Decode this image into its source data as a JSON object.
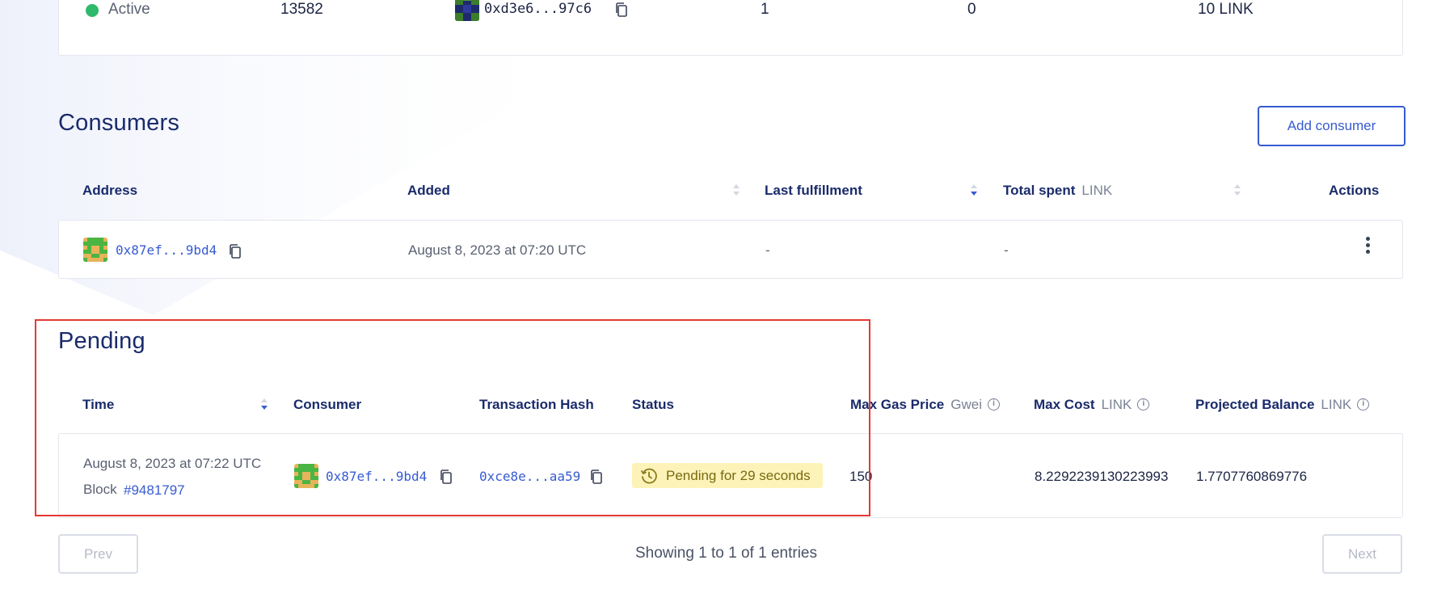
{
  "subscription_row": {
    "status": "Active",
    "id": "13582",
    "owner": "0xd3e6...97c6",
    "consumers_count": "1",
    "fulfillments": "0",
    "balance": "10 LINK"
  },
  "consumers": {
    "title": "Consumers",
    "add_button": "Add consumer",
    "columns": {
      "address": "Address",
      "added": "Added",
      "last_fulfillment": "Last fulfillment",
      "total_spent": "Total spent",
      "total_spent_unit": "LINK",
      "actions": "Actions"
    },
    "rows": [
      {
        "address": "0x87ef...9bd4",
        "added": "August 8, 2023 at 07:20 UTC",
        "last_fulfillment": "-",
        "total_spent": "-"
      }
    ]
  },
  "pending": {
    "title": "Pending",
    "columns": {
      "time": "Time",
      "consumer": "Consumer",
      "tx_hash": "Transaction Hash",
      "status": "Status",
      "max_gas_price": "Max Gas Price",
      "max_gas_price_unit": "Gwei",
      "max_cost": "Max Cost",
      "max_cost_unit": "LINK",
      "projected_balance": "Projected Balance",
      "projected_balance_unit": "LINK"
    },
    "rows": [
      {
        "time": "August 8, 2023 at 07:22 UTC",
        "block_label": "Block",
        "block": "#9481797",
        "consumer": "0x87ef...9bd4",
        "tx_hash": "0xce8e...aa59",
        "status": "Pending for 29 seconds",
        "max_gas_price": "150",
        "max_cost": "8.2292239130223993",
        "projected_balance": "1.7707760869776"
      }
    ]
  },
  "pagination": {
    "prev": "Prev",
    "next": "Next",
    "summary": "Showing 1 to 1 of 1 entries"
  },
  "colors": {
    "accent": "#375bd2",
    "heading": "#1a2b6b",
    "active": "#2fb96c",
    "pending_bg": "#fdf3b9",
    "highlight": "#e53935"
  },
  "icons": {
    "copy": "copy-icon",
    "sort": "sort-icon",
    "info": "info-icon",
    "clock": "clock-icon",
    "kebab": "more-vertical-icon"
  }
}
